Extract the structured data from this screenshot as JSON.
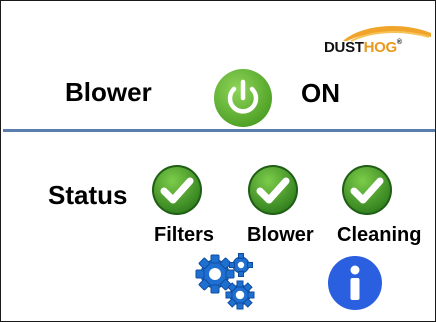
{
  "brand": {
    "part1": "DUST",
    "part2": "HOG",
    "trademark": "®"
  },
  "blower": {
    "label": "Blower",
    "state": "ON"
  },
  "status": {
    "label": "Status",
    "items": [
      {
        "label": "Filters",
        "state": "ok"
      },
      {
        "label": "Blower",
        "state": "ok"
      },
      {
        "label": "Cleaning",
        "state": "ok"
      }
    ]
  },
  "icons": {
    "power": "power-icon",
    "check": "check-icon",
    "settings": "gears-icon",
    "info": "info-icon"
  },
  "colors": {
    "accent_green": "#5fb82e",
    "check_green": "#3a8f27",
    "divider_blue": "#5b7fad",
    "settings_blue": "#1e6fd0",
    "info_blue": "#2a5fe0",
    "logo_orange": "#e89a1e"
  }
}
